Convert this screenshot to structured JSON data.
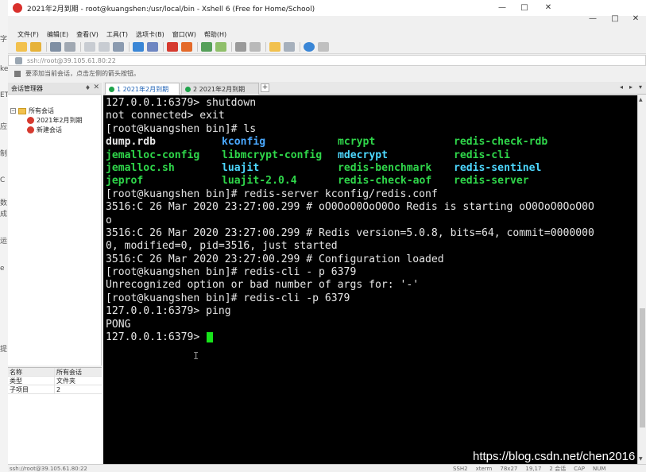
{
  "behind_fragments": [
    "字",
    "ke",
    "ET",
    "应",
    "C",
    "数",
    "制",
    "成",
    "运",
    "e",
    "提"
  ],
  "window": {
    "title": "2021年2月到期 - root@kuangshen:/usr/local/bin - Xshell 6 (Free for Home/School)",
    "controls": {
      "minimize": "—",
      "maximize": "□",
      "close": "✕"
    }
  },
  "menu": [
    "文件(F)",
    "编辑(E)",
    "查看(V)",
    "工具(T)",
    "选项卡(B)",
    "窗口(W)",
    "帮助(H)"
  ],
  "address": {
    "value": "ssh://root@39.105.61.80:22"
  },
  "hint": {
    "text": "要添加当前会话，点击左侧的箭头按钮。"
  },
  "sidebar": {
    "title": "会话管理器",
    "pin": "♦",
    "close": "✕",
    "tree": {
      "root": "所有会话",
      "children": [
        "2021年2月到期",
        "新建会话"
      ]
    }
  },
  "properties": {
    "headers": [
      "名称",
      "所有会话"
    ],
    "rows": [
      [
        "类型",
        "文件夹"
      ],
      [
        "子项目",
        "2"
      ]
    ]
  },
  "tabs": [
    {
      "label": "1 2021年2月到期",
      "active": true,
      "dot_color": "#1ea34a"
    },
    {
      "label": "2 2021年2月到期",
      "active": false,
      "dot_color": "#1ea34a"
    }
  ],
  "tab_controls": {
    "add": "+",
    "prev": "◂",
    "next": "▸",
    "menu": "▾"
  },
  "terminal": {
    "lines_before": [
      "127.0.0.1:6379> shutdown",
      "not connected> exit",
      "[root@kuangshen bin]# ls"
    ],
    "ls_rows": [
      [
        {
          "text": "dump.rdb",
          "color": "#e6e6e6"
        },
        {
          "text": "kconfig",
          "color": "#4aa8ff"
        },
        {
          "text": "mcrypt",
          "color": "#2fd64a"
        },
        {
          "text": "redis-check-rdb",
          "color": "#2fd64a"
        }
      ],
      [
        {
          "text": "jemalloc-config",
          "color": "#2fd64a"
        },
        {
          "text": "libmcrypt-config",
          "color": "#2fd64a"
        },
        {
          "text": "mdecrypt",
          "color": "#4dd8ff"
        },
        {
          "text": "redis-cli",
          "color": "#2fd64a"
        }
      ],
      [
        {
          "text": "jemalloc.sh",
          "color": "#2fd64a"
        },
        {
          "text": "luajit",
          "color": "#4dd8ff"
        },
        {
          "text": "redis-benchmark",
          "color": "#2fd64a"
        },
        {
          "text": "redis-sentinel",
          "color": "#4dd8ff"
        }
      ],
      [
        {
          "text": "jeprof",
          "color": "#2fd64a"
        },
        {
          "text": "luajit-2.0.4",
          "color": "#2fd64a"
        },
        {
          "text": "redis-check-aof",
          "color": "#2fd64a"
        },
        {
          "text": "redis-server",
          "color": "#2fd64a"
        }
      ]
    ],
    "lines_after": [
      "[root@kuangshen bin]# redis-server kconfig/redis.conf",
      "3516:C 26 Mar 2020 23:27:00.299 # oO0OoO0OoO0Oo Redis is starting oO0OoO0OoO0O",
      "o",
      "3516:C 26 Mar 2020 23:27:00.299 # Redis version=5.0.8, bits=64, commit=0000000",
      "0, modified=0, pid=3516, just started",
      "3516:C 26 Mar 2020 23:27:00.299 # Configuration loaded",
      "[root@kuangshen bin]# redis-cli - p 6379",
      "Unrecognized option or bad number of args for: '-'",
      "[root@kuangshen bin]# redis-cli -p 6379",
      "127.0.0.1:6379> ping",
      "PONG",
      "127.0.0.1:6379> "
    ],
    "ibeam": "I",
    "cursor_color": "#17e31a"
  },
  "statusbar": {
    "left": "ssh://root@39.105.61.80:22",
    "right": [
      "SSH2",
      "xterm",
      "78x27",
      "19,17",
      "2 会话",
      "CAP",
      "NUM"
    ]
  },
  "watermark": "https://blog.csdn.net/chen2016"
}
